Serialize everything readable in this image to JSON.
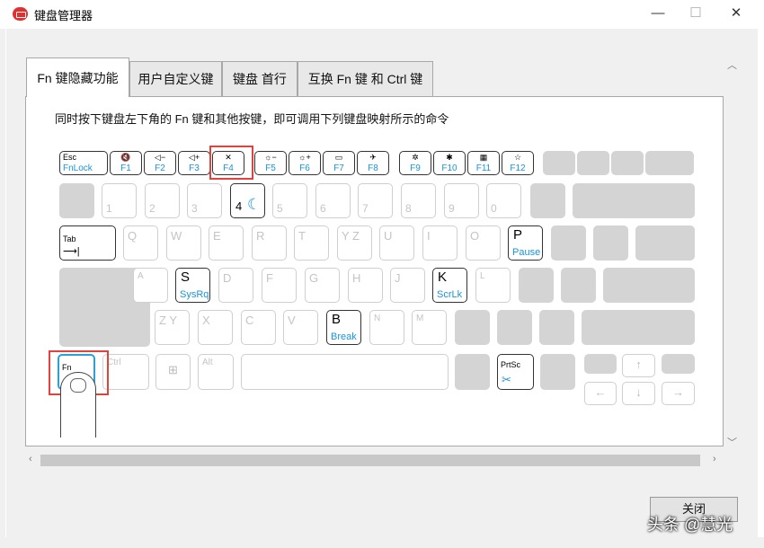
{
  "window": {
    "title": "键盘管理器",
    "minimize": "—",
    "maximize": "☐",
    "close": "✕"
  },
  "tabs": [
    {
      "label": "Fn 键隐藏功能",
      "active": true
    },
    {
      "label": "用户自定义键",
      "active": false
    },
    {
      "label": "键盘 首行",
      "active": false
    },
    {
      "label": "互换 Fn 键 和 Ctrl 键",
      "active": false
    }
  ],
  "instruction": "同时按下键盘左下角的 Fn 键和其他按键，即可调用下列键盘映射所示的命令",
  "keys": {
    "esc": {
      "top": "Esc",
      "sub": "FnLock"
    },
    "f": [
      "F1",
      "F2",
      "F3",
      "F4",
      "F5",
      "F6",
      "F7",
      "F8",
      "F9",
      "F10",
      "F11",
      "F12"
    ],
    "f_icons": [
      "🔇",
      "◁−",
      "◁+",
      "✕",
      "☼−",
      "☼+",
      "▭",
      "✈",
      "✲",
      "✱",
      "▦",
      "☆"
    ],
    "digits": [
      "1",
      "2",
      "3",
      "4",
      "5",
      "6",
      "7",
      "8",
      "9",
      "0"
    ],
    "key4_icon": "☾",
    "tab": "Tab",
    "row_q": [
      "Q",
      "W",
      "E",
      "R",
      "T",
      "Y Z",
      "U",
      "I",
      "O"
    ],
    "p": {
      "label": "P",
      "sub": "Pause"
    },
    "row_a_before": [
      "A"
    ],
    "s": {
      "label": "S",
      "sub": "SysRq"
    },
    "row_a_mid": [
      "D",
      "F",
      "G",
      "H",
      "J"
    ],
    "k": {
      "label": "K",
      "sub": "ScrLk"
    },
    "l": "L",
    "row_z_before": [
      "Z Y",
      "X",
      "C",
      "V"
    ],
    "b": {
      "label": "B",
      "sub": "Break"
    },
    "row_z_after": [
      "N",
      "M"
    ],
    "fn": "Fn",
    "ctrl": "Ctrl",
    "alt": "Alt",
    "prtsc": "PrtSc",
    "arrows": {
      "up": "↑",
      "left": "←",
      "down": "↓",
      "right": "→"
    }
  },
  "close_button": "关闭",
  "watermark": "头条 @慧光",
  "colors": {
    "highlight": "#e0433c",
    "accent": "#1a94d8"
  }
}
